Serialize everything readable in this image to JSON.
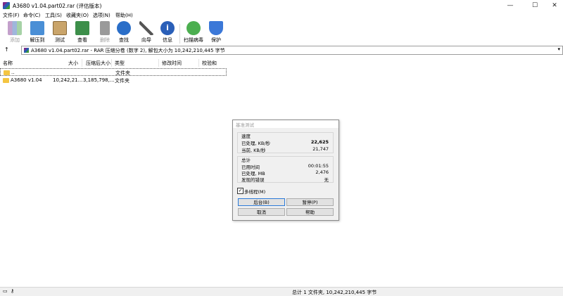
{
  "window": {
    "title": "A3680 v1.04.part02.rar (评估版本)"
  },
  "menu": [
    "文件(F)",
    "命令(C)",
    "工具(S)",
    "收藏夹(O)",
    "选项(N)",
    "帮助(H)"
  ],
  "toolbar": [
    {
      "label": "添加",
      "icon": "add-archive-icon",
      "enabled": false
    },
    {
      "label": "解压到",
      "icon": "extract-folder-icon",
      "enabled": true
    },
    {
      "label": "测试",
      "icon": "test-clipboard-icon",
      "enabled": true
    },
    {
      "label": "查看",
      "icon": "view-book-icon",
      "enabled": true
    },
    {
      "label": "删除",
      "icon": "trash-icon",
      "enabled": false
    },
    {
      "label": "查找",
      "icon": "magnifier-icon",
      "enabled": true
    },
    {
      "label": "向导",
      "icon": "wand-icon",
      "enabled": true
    },
    {
      "label": "信息",
      "icon": "info-icon",
      "enabled": true
    },
    {
      "label": "扫描病毒",
      "icon": "virus-scan-icon",
      "enabled": true
    },
    {
      "label": "保护",
      "icon": "shield-icon",
      "enabled": true
    }
  ],
  "address": {
    "path": "A3680 v1.04.part02.rar - RAR 压缩分卷 (数字 2), 解包大小为 10,242,210,445 字节"
  },
  "columns": [
    "名称",
    "大小",
    "压缩后大小",
    "类型",
    "修改时间",
    "校验和"
  ],
  "rows": [
    {
      "name": "..",
      "size": "",
      "packed": "",
      "type": "文件夹",
      "modified": "",
      "crc": ""
    },
    {
      "name": "A3680 v1.04",
      "size": "10,242,21...",
      "packed": "3,185,798,...",
      "type": "文件夹",
      "modified": "",
      "crc": ""
    }
  ],
  "dialog": {
    "title": "基准测试",
    "speed_label": "速度",
    "processed_label": "已处理, KB/秒",
    "processed_value": "22,625",
    "current_label": "当前, KB/秒",
    "current_value": "21,747",
    "total_label": "总计",
    "elapsed_label": "已用时间",
    "elapsed_value": "00:01:55",
    "processed_mb_label": "已处理, MB",
    "processed_mb_value": "2,476",
    "errors_label": "发现的错误",
    "errors_value": "无",
    "multithread_label": "多线程(M)",
    "multithread_checked": true,
    "buttons": {
      "background": "后台(B)",
      "pause": "暂停(P)",
      "cancel": "取消",
      "help": "帮助"
    }
  },
  "status": {
    "text": "总计 1 文件夹, 10,242,210,445 字节"
  },
  "colors": {
    "accent": "#2b7ad8",
    "folder": "#f4c542"
  }
}
